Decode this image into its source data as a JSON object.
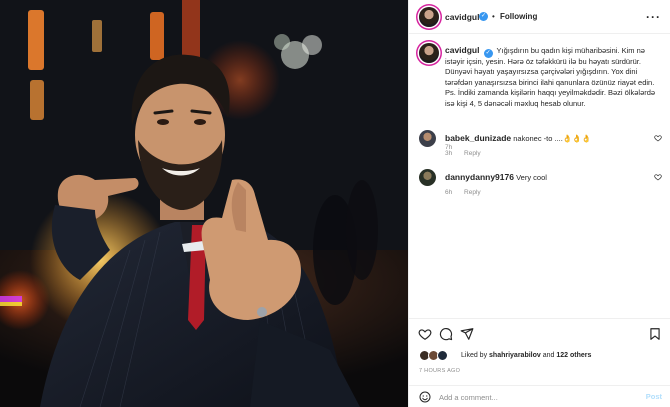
{
  "post": {
    "username": "cavidgul",
    "follow_status": "Following",
    "caption": "Yığışdırın bu qadın kişi müharibəsini. Kim nə istəyir içsin, yesin. Hərə öz təfəkkürü ilə bu həyatı sürdürür. Dünyəvi həyatı yaşayırsızsa çərçivələri yığışdırın. Yox dini tərəfdən yanaşırsızsa birinci ilahi qanunlara özünüz riayət edin. Ps. İndiki zamanda kişilərin haqqı yeyilməkdədir. Bəzi ölkələrdə isə kişi 4, 5 dənəcəli məxluq hesab olunur.",
    "caption_age": "7h"
  },
  "comments": [
    {
      "username": "babek_dunizade",
      "text": "nakonec -to ....👌👌👌",
      "age": "3h",
      "reply_label": "Reply"
    },
    {
      "username": "dannydanny9176",
      "text": "Very cool",
      "age": "6h",
      "reply_label": "Reply"
    }
  ],
  "likes": {
    "prefix": "Liked by",
    "user": "shahriyarabilov",
    "connector": "and",
    "others": "122 others"
  },
  "timestamp": "7 HOURS AGO",
  "add_comment": {
    "placeholder": "Add a comment...",
    "post_label": "Post"
  },
  "colors": {
    "verified": "#3897f0",
    "story_ring": "#d6249f",
    "post_button": "#b2dffc",
    "muted": "#8e8e8e"
  },
  "icons": [
    "verified-badge-icon",
    "more-options-icon",
    "heart-icon",
    "comment-icon",
    "share-icon",
    "bookmark-icon",
    "emoji-icon"
  ]
}
